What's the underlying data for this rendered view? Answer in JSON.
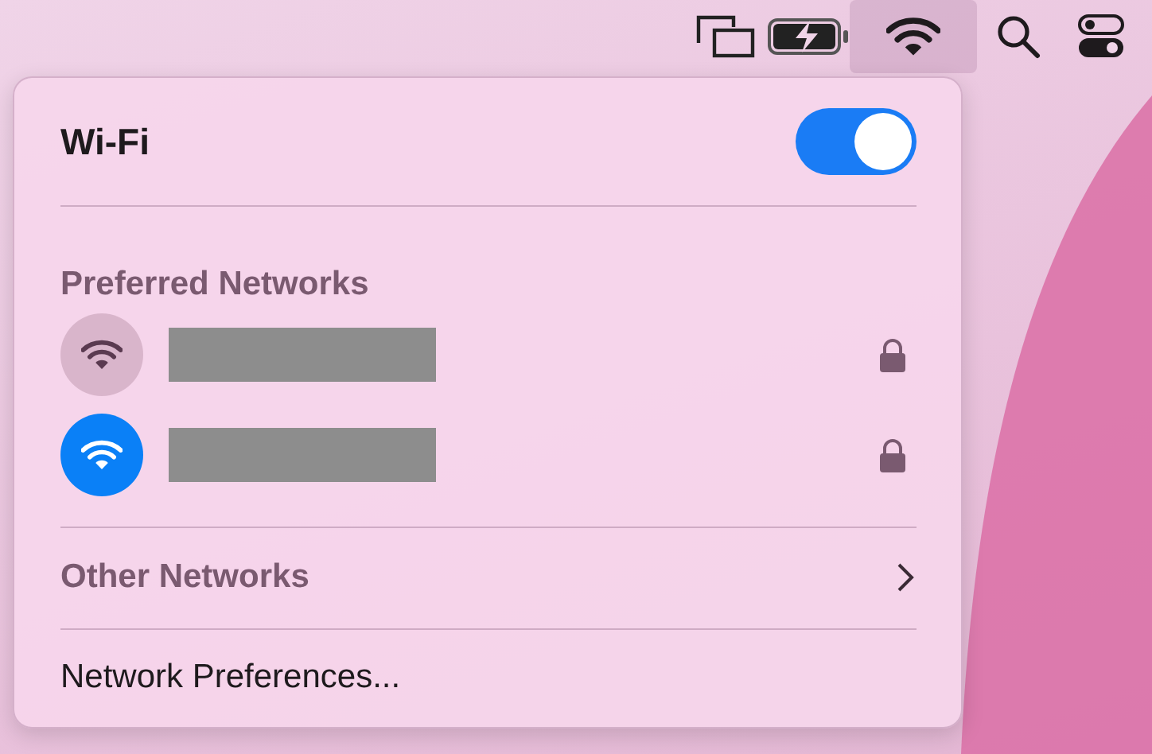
{
  "menu_bar": {
    "wifi_active": true
  },
  "wifi": {
    "title": "Wi-Fi",
    "on": true
  },
  "preferred": {
    "heading": "Preferred Networks",
    "networks": [
      {
        "connected": false,
        "locked": true
      },
      {
        "connected": true,
        "locked": true
      }
    ]
  },
  "other": {
    "label": "Other Networks",
    "expanded": false
  },
  "preferences": {
    "label": "Network Preferences..."
  }
}
